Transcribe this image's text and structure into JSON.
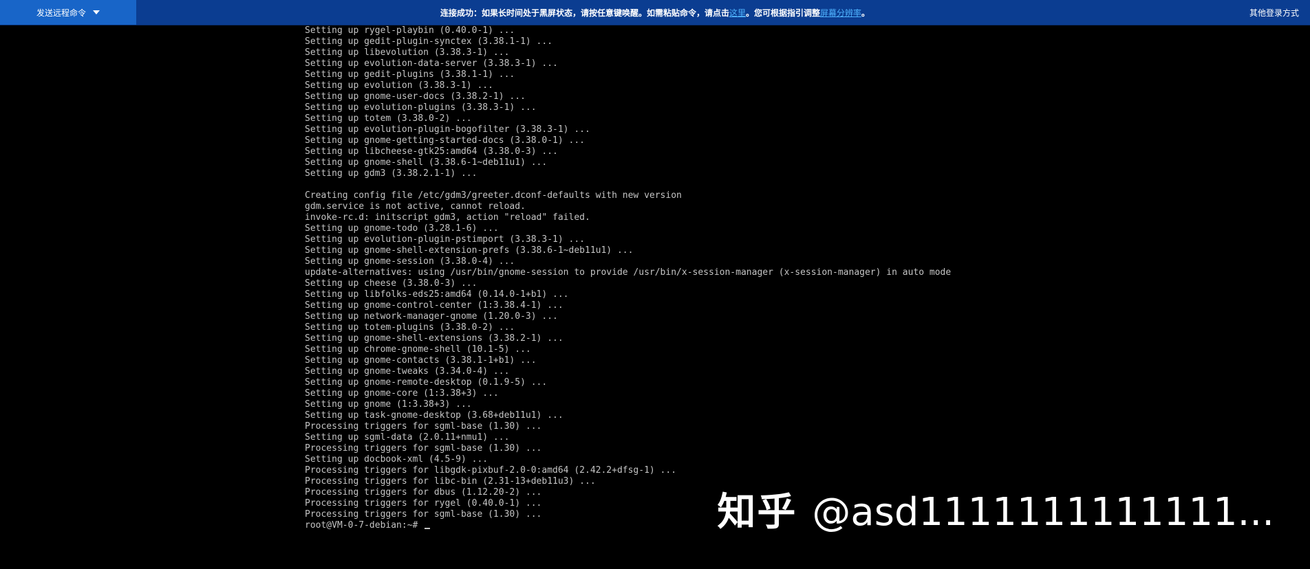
{
  "toolbar": {
    "send_command_label": "发送远程命令",
    "notice_prefix": "连接成功：如果长时间处于黑屏状态，请按任意键唤醒。如需粘贴命令，请点击",
    "notice_link1": "这里",
    "notice_middle": "。您可根据指引调整",
    "notice_link2": "屏幕分辨率",
    "notice_suffix": "。",
    "other_login_label": "其他登录方式"
  },
  "terminal": {
    "lines": [
      "Setting up rygel-playbin (0.40.0-1) ...",
      "Setting up gedit-plugin-synctex (3.38.1-1) ...",
      "Setting up libevolution (3.38.3-1) ...",
      "Setting up evolution-data-server (3.38.3-1) ...",
      "Setting up gedit-plugins (3.38.1-1) ...",
      "Setting up evolution (3.38.3-1) ...",
      "Setting up gnome-user-docs (3.38.2-1) ...",
      "Setting up evolution-plugins (3.38.3-1) ...",
      "Setting up totem (3.38.0-2) ...",
      "Setting up evolution-plugin-bogofilter (3.38.3-1) ...",
      "Setting up gnome-getting-started-docs (3.38.0-1) ...",
      "Setting up libcheese-gtk25:amd64 (3.38.0-3) ...",
      "Setting up gnome-shell (3.38.6-1~deb11u1) ...",
      "Setting up gdm3 (3.38.2.1-1) ...",
      "",
      "Creating config file /etc/gdm3/greeter.dconf-defaults with new version",
      "gdm.service is not active, cannot reload.",
      "invoke-rc.d: initscript gdm3, action \"reload\" failed.",
      "Setting up gnome-todo (3.28.1-6) ...",
      "Setting up evolution-plugin-pstimport (3.38.3-1) ...",
      "Setting up gnome-shell-extension-prefs (3.38.6-1~deb11u1) ...",
      "Setting up gnome-session (3.38.0-4) ...",
      "update-alternatives: using /usr/bin/gnome-session to provide /usr/bin/x-session-manager (x-session-manager) in auto mode",
      "Setting up cheese (3.38.0-3) ...",
      "Setting up libfolks-eds25:amd64 (0.14.0-1+b1) ...",
      "Setting up gnome-control-center (1:3.38.4-1) ...",
      "Setting up network-manager-gnome (1.20.0-3) ...",
      "Setting up totem-plugins (3.38.0-2) ...",
      "Setting up gnome-shell-extensions (3.38.2-1) ...",
      "Setting up chrome-gnome-shell (10.1-5) ...",
      "Setting up gnome-contacts (3.38.1-1+b1) ...",
      "Setting up gnome-tweaks (3.34.0-4) ...",
      "Setting up gnome-remote-desktop (0.1.9-5) ...",
      "Setting up gnome-core (1:3.38+3) ...",
      "Setting up gnome (1:3.38+3) ...",
      "Setting up task-gnome-desktop (3.68+deb11u1) ...",
      "Processing triggers for sgml-base (1.30) ...",
      "Setting up sgml-data (2.0.11+nmu1) ...",
      "Processing triggers for sgml-base (1.30) ...",
      "Setting up docbook-xml (4.5-9) ...",
      "Processing triggers for libgdk-pixbuf-2.0-0:amd64 (2.42.2+dfsg-1) ...",
      "Processing triggers for libc-bin (2.31-13+deb11u3) ...",
      "Processing triggers for dbus (1.12.20-2) ...",
      "Processing triggers for rygel (0.40.0-1) ...",
      "Processing triggers for sgml-base (1.30) ..."
    ],
    "prompt": "root@VM-0-7-debian:~# "
  },
  "watermark": {
    "logo": "知乎",
    "handle": "@asd1111111111111..."
  },
  "colors": {
    "topbar_bg": "#0b3d91",
    "button_bg": "#1865c8",
    "link": "#4fb3ff",
    "terminal_fg": "#c4c4c4",
    "terminal_bg": "#000000"
  }
}
